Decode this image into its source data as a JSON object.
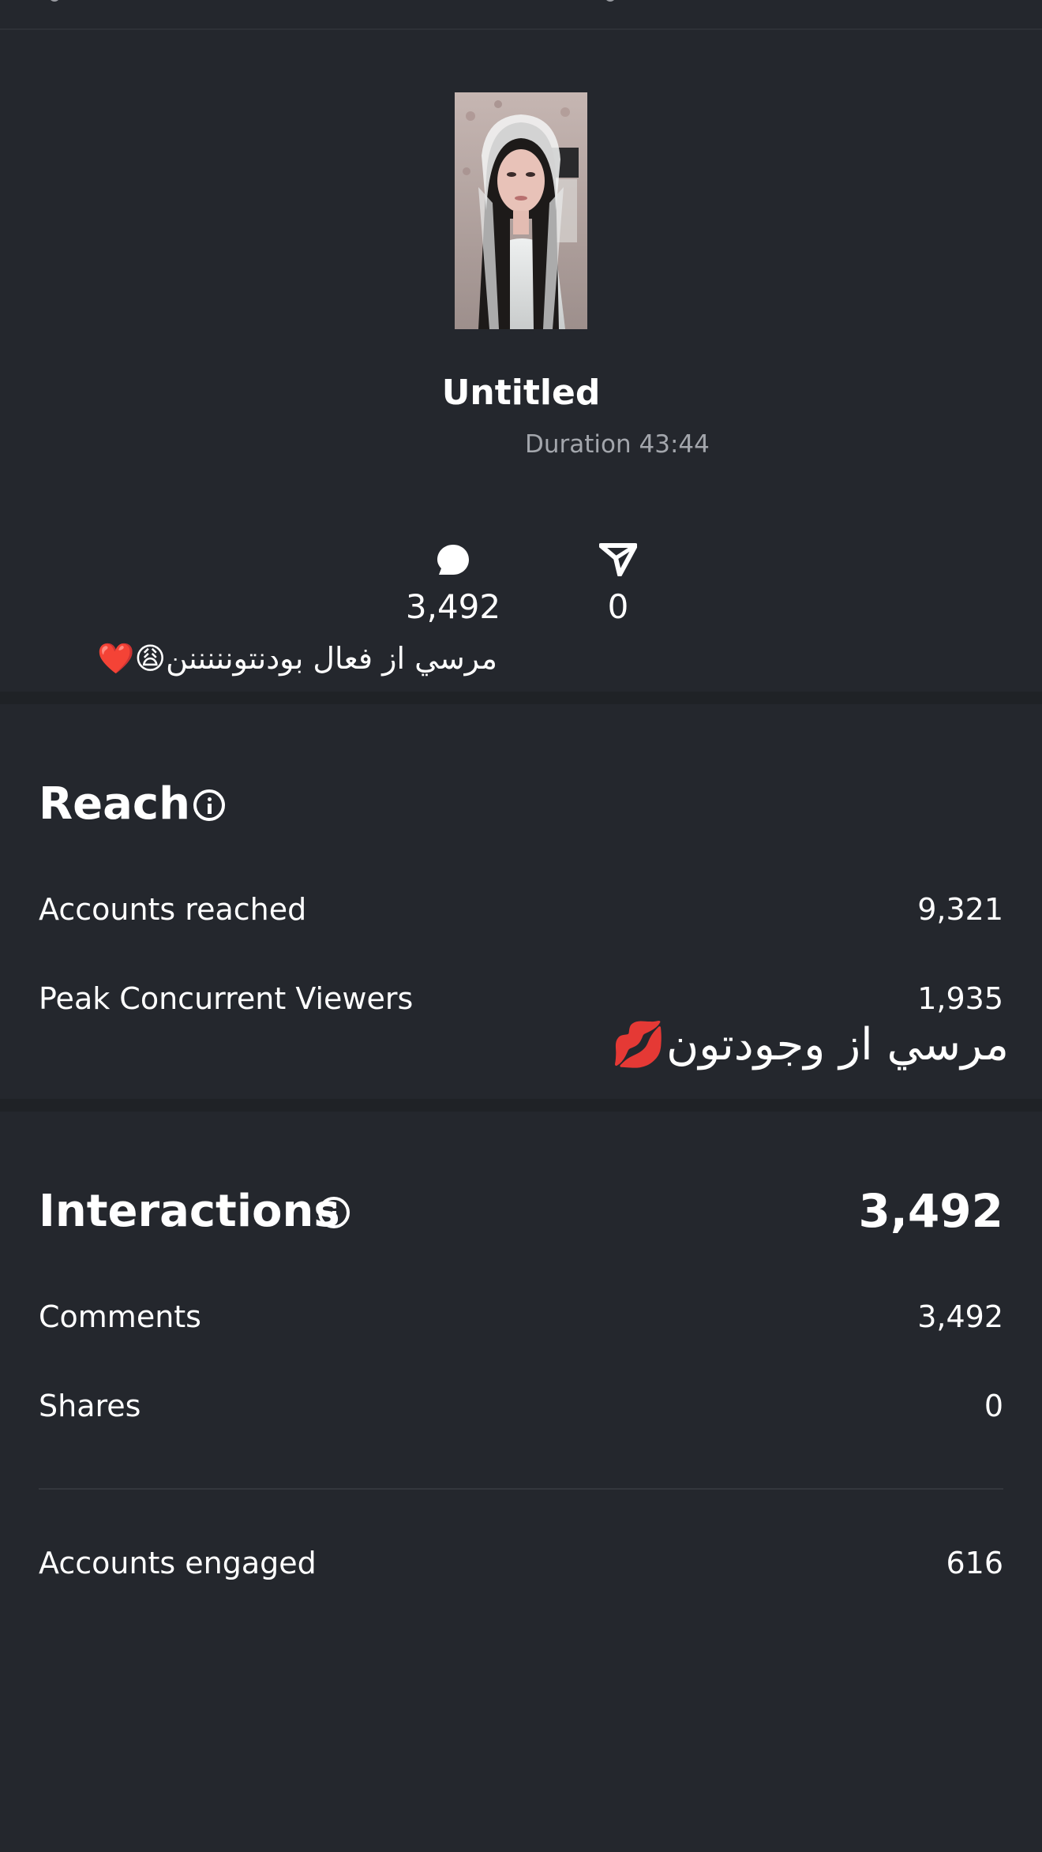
{
  "live": {
    "title": "Untitled",
    "duration": "Duration 43:44",
    "thumbnail_alt": "live-video-thumbnail"
  },
  "metrics": {
    "comments_count": "3,492",
    "shares_count": "0"
  },
  "overlays": {
    "comment_small": "مرسي از فعال بودنتونننننن😩❤️",
    "comment_large": "مرسي از وجودتون💋"
  },
  "reach": {
    "title": "Reach",
    "rows": [
      {
        "label": "Accounts reached",
        "value": "9,321"
      },
      {
        "label": "Peak Concurrent Viewers",
        "value": "1,935"
      }
    ]
  },
  "interactions": {
    "title": "Interactions",
    "total": "3,492",
    "rows": [
      {
        "label": "Comments",
        "value": "3,492"
      },
      {
        "label": "Shares",
        "value": "0"
      }
    ],
    "engaged": {
      "label": "Accounts engaged",
      "value": "616"
    }
  },
  "icons": {
    "comment": "comment-bubble-icon",
    "share": "paper-plane-icon",
    "info": "info-icon"
  },
  "colors": {
    "background": "#24272d",
    "divider": "#1f2226",
    "muted_text": "#a3a6ac"
  }
}
